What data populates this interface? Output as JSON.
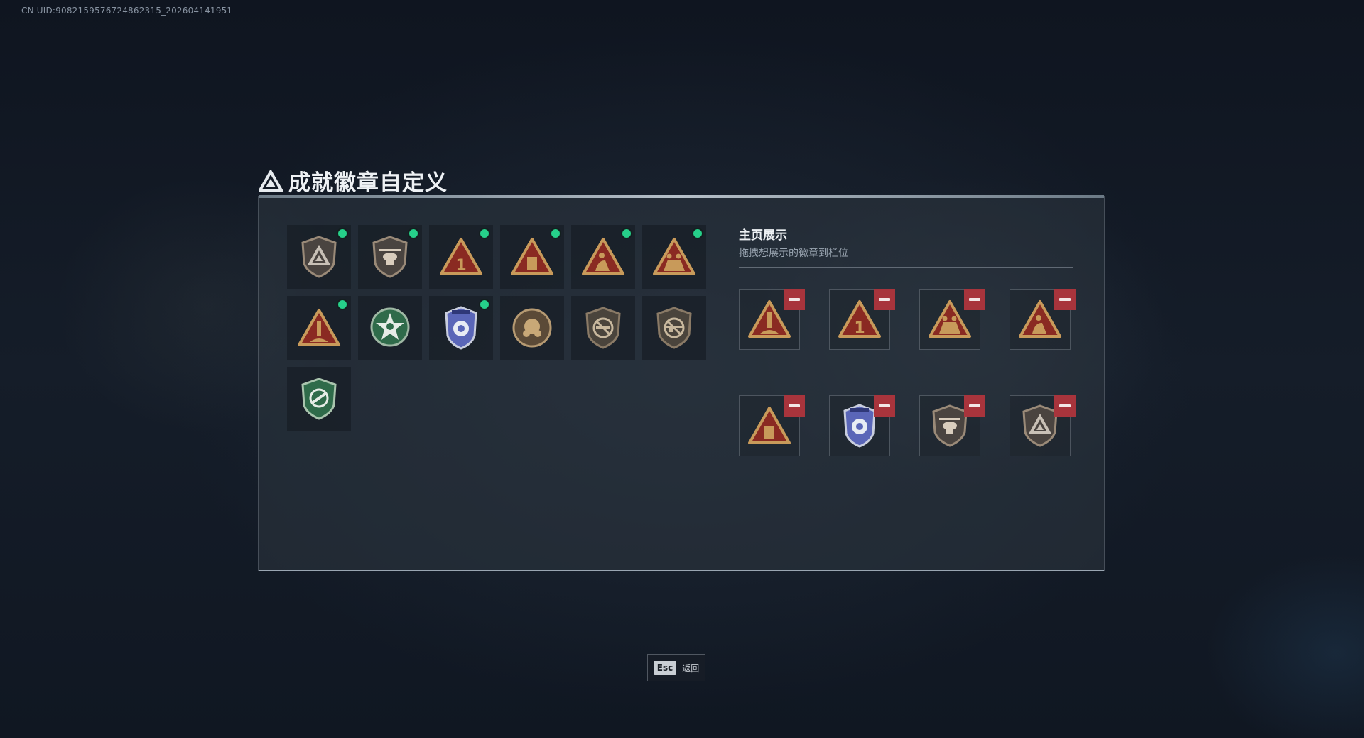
{
  "uid_text": "CN UID:9082159576724862315_202604141951",
  "title": "成就徽章自定义",
  "showcase": {
    "title": "主页展示",
    "subtitle": "拖拽想展示的徽章到栏位",
    "slots": [
      {
        "badge": "tri-rocket-icon"
      },
      {
        "badge": "tri-one-icon"
      },
      {
        "badge": "tri-soldiers-icon"
      },
      {
        "badge": "tri-crouch-soldier-icon"
      },
      {
        "badge": "tri-box-icon"
      },
      {
        "badge": "police-shield-icon"
      },
      {
        "badge": "shield-helicopter-icon"
      },
      {
        "badge": "shield-triangle-icon"
      }
    ]
  },
  "badges": [
    {
      "icon": "shield-triangle-icon",
      "equipped": true
    },
    {
      "icon": "shield-helicopter-icon",
      "equipped": true
    },
    {
      "icon": "tri-one-icon",
      "equipped": true
    },
    {
      "icon": "tri-box-icon",
      "equipped": true
    },
    {
      "icon": "tri-crouch-soldier-icon",
      "equipped": true
    },
    {
      "icon": "tri-soldiers-icon",
      "equipped": true
    },
    {
      "icon": "tri-rocket-icon",
      "equipped": true
    },
    {
      "icon": "green-star-medal-icon",
      "equipped": false
    },
    {
      "icon": "police-shield-icon",
      "equipped": true
    },
    {
      "icon": "bronze-round-medal-icon",
      "equipped": false
    },
    {
      "icon": "shield-no-gun-icon",
      "equipped": false
    },
    {
      "icon": "shield-no-rifle-icon",
      "equipped": false
    },
    {
      "icon": "green-shield-rifle-icon",
      "equipped": false
    }
  ],
  "footer": {
    "esc_key": "Esc",
    "esc_label": "返回"
  },
  "colors": {
    "equipped_dot": "#26d08a",
    "remove_button": "#a8343c",
    "bronze": "#c89a5a",
    "badge_red": "#8a2a22"
  }
}
